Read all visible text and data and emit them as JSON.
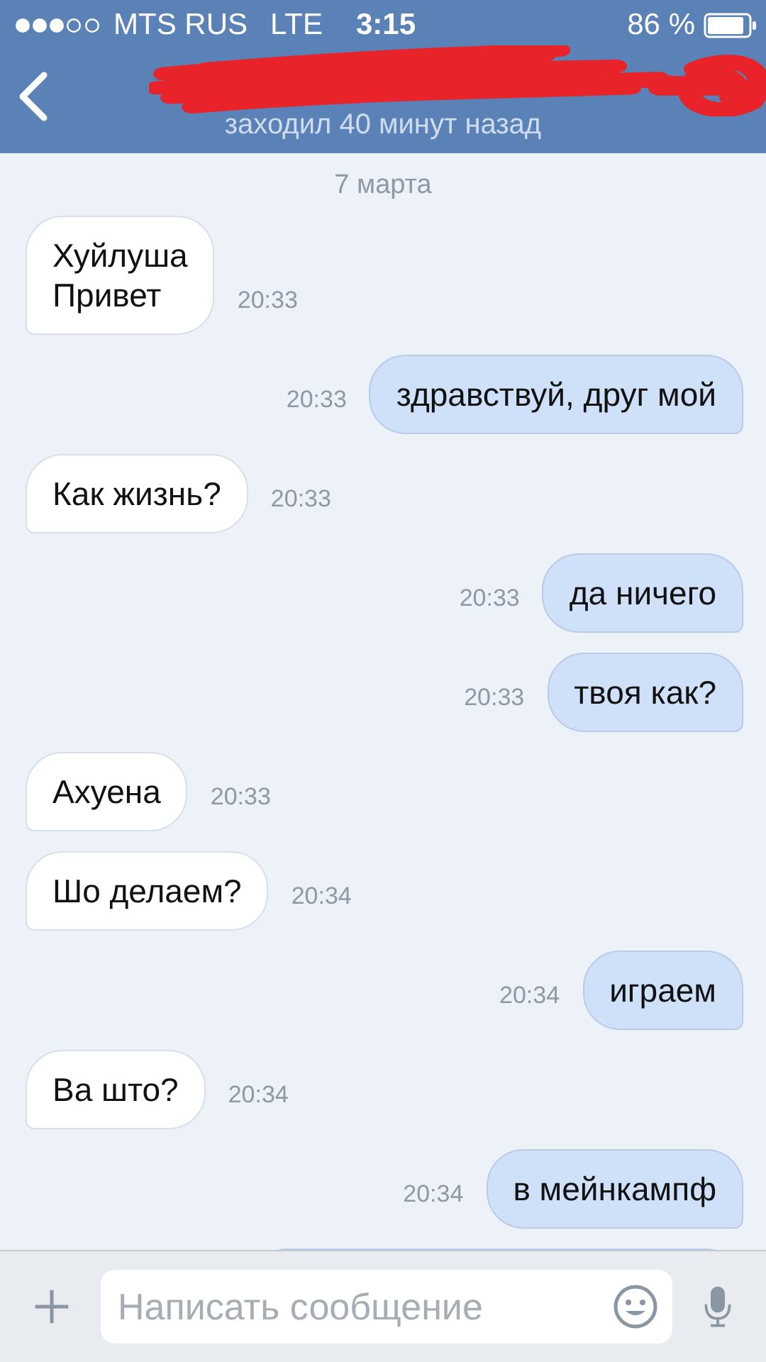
{
  "status_bar": {
    "carrier": "MTS RUS",
    "network": "LTE",
    "time": "3:15",
    "battery": "86 %"
  },
  "header": {
    "subtitle": "заходил 40 минут назад"
  },
  "date": "7 марта",
  "messages": [
    {
      "outgoing": false,
      "text": "Хуйлуша\nПривет",
      "time": "20:33"
    },
    {
      "outgoing": true,
      "text": "здравствуй, друг мой",
      "time": "20:33"
    },
    {
      "outgoing": false,
      "text": "Как жизнь?",
      "time": "20:33"
    },
    {
      "outgoing": true,
      "text": "да ничего",
      "time": "20:33"
    },
    {
      "outgoing": true,
      "text": "твоя как?",
      "time": "20:33"
    },
    {
      "outgoing": false,
      "text": "Ахуена",
      "time": "20:33"
    },
    {
      "outgoing": false,
      "text": "Шо делаем?",
      "time": "20:34"
    },
    {
      "outgoing": true,
      "text": "играем",
      "time": "20:34"
    },
    {
      "outgoing": false,
      "text": "Ва што?",
      "time": "20:34"
    },
    {
      "outgoing": true,
      "text": "в мейнкампф",
      "time": "20:34"
    },
    {
      "outgoing": true
    }
  ],
  "composer": {
    "placeholder": "Написать сообщение"
  }
}
